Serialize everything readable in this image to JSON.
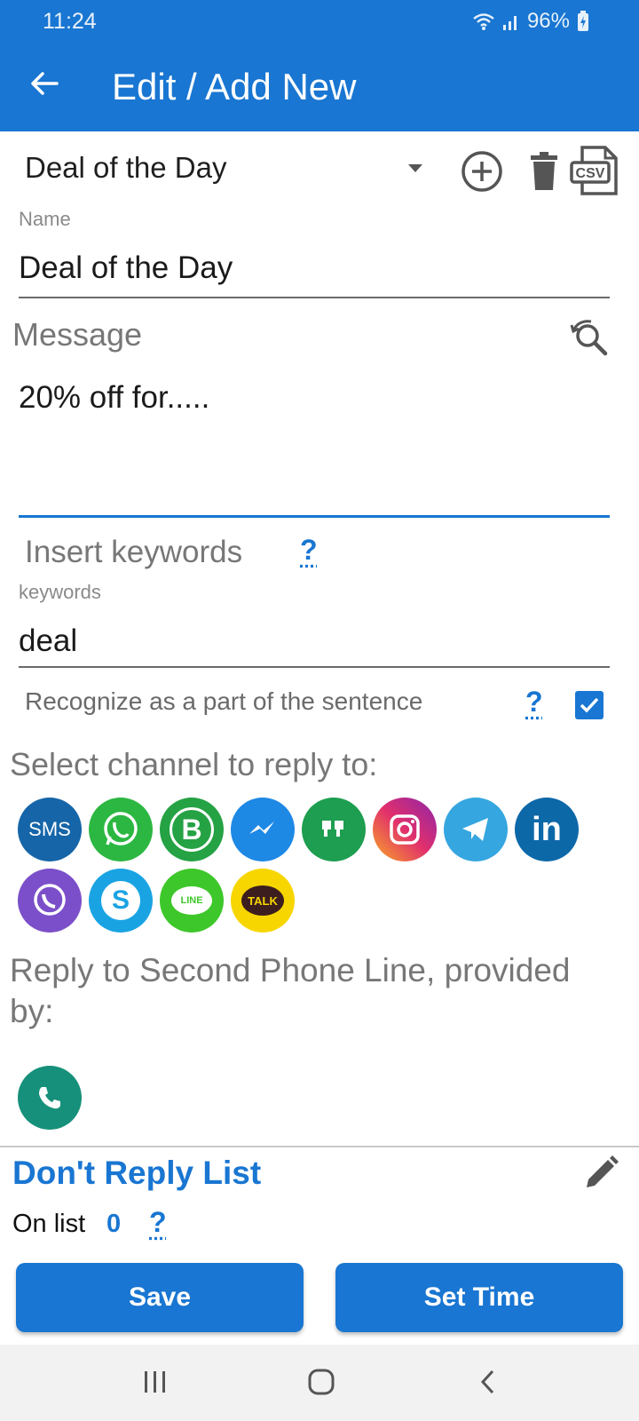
{
  "status_bar": {
    "time": "11:24",
    "battery": "96%"
  },
  "app_bar": {
    "title": "Edit / Add New",
    "back_icon": "arrow-left-icon"
  },
  "selector": {
    "value": "Deal of the Day",
    "icons": [
      "add-circle-icon",
      "trash-icon",
      "csv-file-icon"
    ],
    "csv_label": "CSV"
  },
  "name_field": {
    "label": "Name",
    "value": "Deal of the Day"
  },
  "message": {
    "heading": "Message",
    "value": "20% off for.....",
    "icon": "search-refresh-icon"
  },
  "keywords": {
    "heading": "Insert keywords",
    "help": "?",
    "label": "keywords",
    "value": "deal",
    "recognize_label": "Recognize as a part of the sentence",
    "recognize_help": "?",
    "recognize_checked": true
  },
  "channels": {
    "heading": "Select channel to reply to:",
    "items": [
      {
        "name": "sms",
        "text": "SMS",
        "color": "#1565a8"
      },
      {
        "name": "whatsapp",
        "text": "",
        "color": "#2bb741"
      },
      {
        "name": "whatsapp-business",
        "text": "B",
        "color": "#25a244"
      },
      {
        "name": "messenger",
        "text": "",
        "color": "#1e88e5"
      },
      {
        "name": "hangouts",
        "text": "",
        "color": "#1e9e50"
      },
      {
        "name": "instagram",
        "text": "",
        "color": "#d63384"
      },
      {
        "name": "telegram",
        "text": "",
        "color": "#35a6df"
      },
      {
        "name": "linkedin",
        "text": "in",
        "color": "#0d68a8"
      },
      {
        "name": "viber",
        "text": "",
        "color": "#7b4fc9"
      },
      {
        "name": "skype",
        "text": "S",
        "color": "#1aa3e3"
      },
      {
        "name": "line",
        "text": "LINE",
        "color": "#3ec72a"
      },
      {
        "name": "kakaotalk",
        "text": "TALK",
        "color": "#f7d600"
      }
    ]
  },
  "second_line": {
    "heading": "Reply to Second Phone Line, provided by:",
    "icon": "phone-icon",
    "color": "#16907a"
  },
  "dont_reply": {
    "heading": "Don't Reply List",
    "on_list_label": "On list",
    "count": "0",
    "help": "?",
    "edit_icon": "pencil-icon"
  },
  "buttons": {
    "save": "Save",
    "set_time": "Set Time"
  },
  "nav": {
    "icons": [
      "recent-apps-icon",
      "home-icon",
      "back-icon"
    ]
  },
  "colors": {
    "accent": "#1976d2"
  }
}
